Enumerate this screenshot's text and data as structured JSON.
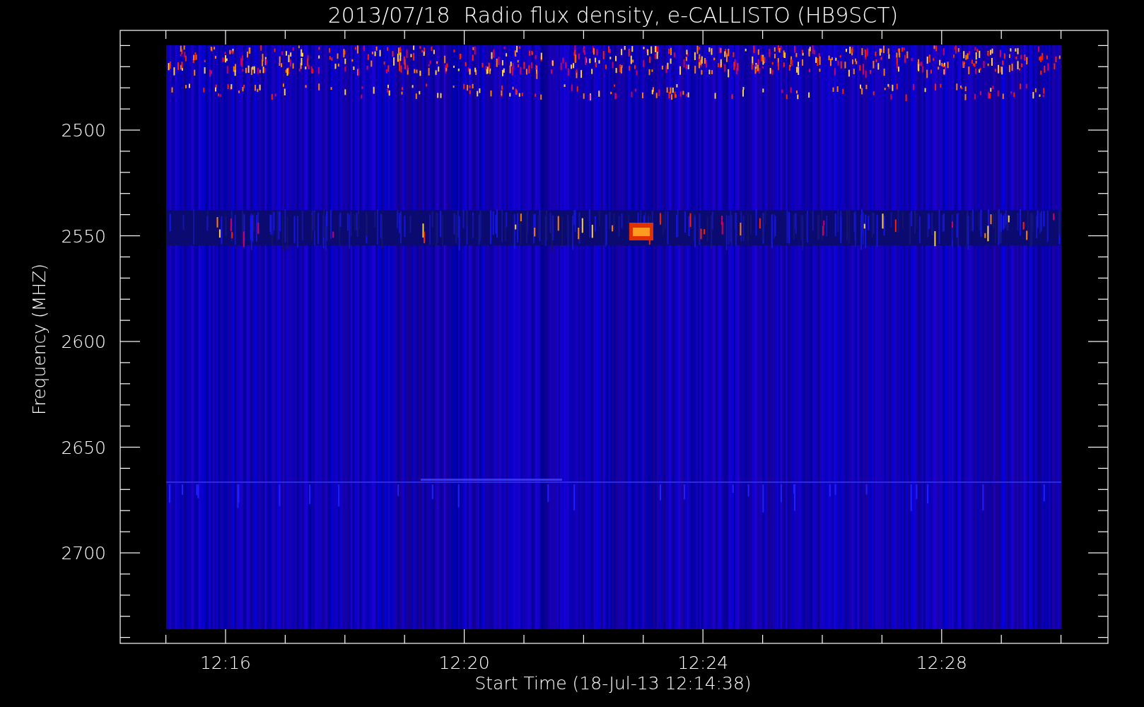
{
  "title": "2013/07/18  Radio flux density, e-CALLISTO (HB9SCT)",
  "ylabel": "Frequency (MHZ)",
  "xlabel": "Start Time (18-Jul-13 12:14:38)",
  "y_tick_labels": [
    "2500",
    "2550",
    "2600",
    "2650",
    "2700"
  ],
  "x_tick_labels": [
    "12:16",
    "12:20",
    "12:24",
    "12:28"
  ]
}
